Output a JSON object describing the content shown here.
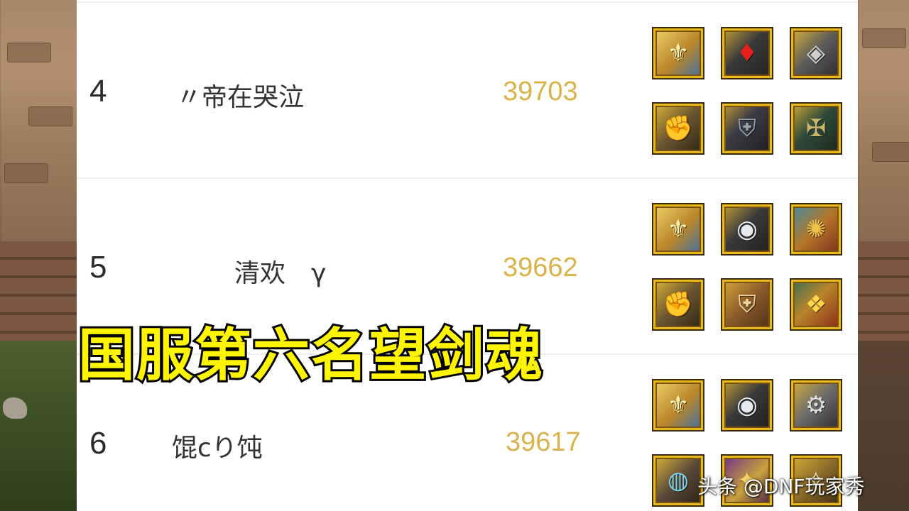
{
  "leaderboard": {
    "rows": [
      {
        "rank": "4",
        "name": "〃帝在哭泣",
        "score": "39703",
        "equipment_icons": [
          "gold-crest-icon",
          "red-gem-bracelet-icon",
          "dark-pendant-icon",
          "gold-gauntlet-icon",
          "black-armor-icon",
          "green-shoulder-icon"
        ]
      },
      {
        "rank": "5",
        "name": "清欢　γ",
        "score": "39662",
        "equipment_icons": [
          "gold-crest-icon",
          "silver-gem-ring-icon",
          "ornate-amulet-icon",
          "gold-gauntlet-icon",
          "brown-armor-icon",
          "red-gold-belt-icon"
        ]
      },
      {
        "rank": "6",
        "name": "馄cり饨",
        "score": "39617",
        "equipment_icons": [
          "gold-crest-icon",
          "silver-gem-ring-icon",
          "silver-amulet-icon",
          "metal-bracer-icon",
          "purple-relic-icon",
          "gold-charm-icon"
        ]
      }
    ]
  },
  "banner": {
    "text": "国服第六名望剑魂"
  },
  "watermark": {
    "text": "头条 @DNF玩家秀"
  },
  "colors": {
    "score": "#d9b24a",
    "banner_fill": "#fff500",
    "banner_stroke": "#000000",
    "icon_frame": "#e8b91a"
  }
}
